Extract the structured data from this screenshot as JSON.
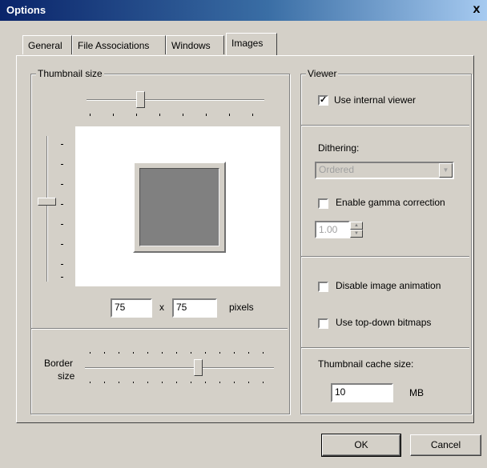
{
  "window": {
    "title": "Options",
    "close_glyph": "x"
  },
  "tabs": [
    {
      "label": "General"
    },
    {
      "label": "File Associations"
    },
    {
      "label": "Windows"
    },
    {
      "label": "Images",
      "active": true
    }
  ],
  "thumbnail": {
    "group_label": "Thumbnail size",
    "width": "75",
    "height": "75",
    "times": "x",
    "unit": "pixels",
    "border_label_1": "Border",
    "border_label_2": "size"
  },
  "viewer": {
    "group_label": "Viewer",
    "use_internal_viewer": {
      "label": "Use internal viewer",
      "checked": true
    },
    "dithering_label": "Dithering:",
    "dithering_value": "Ordered",
    "enable_gamma": {
      "label": "Enable gamma correction",
      "checked": false
    },
    "gamma_value": "1.00",
    "disable_animation": {
      "label": "Disable image animation",
      "checked": false
    },
    "top_down": {
      "label": "Use top-down bitmaps",
      "checked": false
    },
    "cache_label": "Thumbnail cache size:",
    "cache_value": "10",
    "cache_unit": "MB"
  },
  "buttons": {
    "ok": "OK",
    "cancel": "Cancel"
  },
  "icons": {
    "check": "check-icon",
    "dropdown": "chevron-down-icon"
  }
}
